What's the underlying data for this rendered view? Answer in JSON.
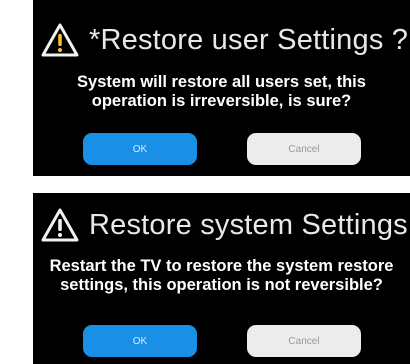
{
  "dialogs": {
    "user": {
      "title": "*Restore user Settings ?",
      "message": "System will restore all users set, this operation is irreversible, is sure?",
      "ok_label": "OK",
      "cancel_label": "Cancel"
    },
    "system": {
      "title": "Restore system Settings",
      "message": "Restart the TV to restore the system restore settings, this operation is not reversible?",
      "ok_label": "OK",
      "cancel_label": "Cancel"
    }
  },
  "colors": {
    "dialog_bg": "#000000",
    "ok_button": "#1a8fe6",
    "cancel_button": "#ececec",
    "warning_icon": "#f2f2f2"
  },
  "icons": [
    "warning-triangle-icon"
  ]
}
